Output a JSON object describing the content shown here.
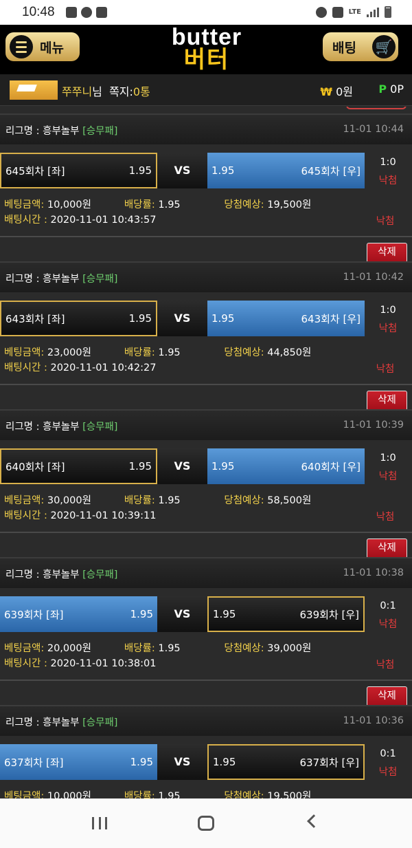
{
  "status": {
    "time": "10:48",
    "lte": "LTE"
  },
  "header": {
    "menu_label": "메뉴",
    "logo_en": "butter",
    "logo_ko": "버터",
    "bet_label": "배팅"
  },
  "user": {
    "nickname": "쭈쭈니",
    "suffix": "님",
    "note_label": "쪽지:",
    "note_count": "0통",
    "currency_symbol": "₩",
    "money": "0원",
    "points_symbol": "P",
    "points": "0P"
  },
  "labels": {
    "league_prefix": "리그명 : ",
    "amount_label": "베팅금액:",
    "rate_label": "배당률:",
    "expect_label": "당첨예상:",
    "time_label": "배팅시간 : ",
    "vs": "VS",
    "delete": "삭제"
  },
  "bets": [
    {
      "league": "흥부놀부",
      "tag": "[승무패]",
      "datetime": "11-01 10:44",
      "left_team": "645회차 [좌]",
      "left_odds": "1.95",
      "right_odds": "1.95",
      "right_team": "645회차 [우]",
      "score": "1:0",
      "result": "낙첨",
      "amount": "10,000원",
      "rate": "1.95",
      "expect": "19,500원",
      "bet_time": "2020-11-01 10:43:57",
      "result2": "낙첨",
      "selected": "left"
    },
    {
      "league": "흥부놀부",
      "tag": "[승무패]",
      "datetime": "11-01 10:42",
      "left_team": "643회차 [좌]",
      "left_odds": "1.95",
      "right_odds": "1.95",
      "right_team": "643회차 [우]",
      "score": "1:0",
      "result": "낙첨",
      "amount": "23,000원",
      "rate": "1.95",
      "expect": "44,850원",
      "bet_time": "2020-11-01 10:42:27",
      "result2": "낙첨",
      "selected": "left"
    },
    {
      "league": "흥부놀부",
      "tag": "[승무패]",
      "datetime": "11-01 10:39",
      "left_team": "640회차 [좌]",
      "left_odds": "1.95",
      "right_odds": "1.95",
      "right_team": "640회차 [우]",
      "score": "1:0",
      "result": "낙첨",
      "amount": "30,000원",
      "rate": "1.95",
      "expect": "58,500원",
      "bet_time": "2020-11-01 10:39:11",
      "result2": "낙첨",
      "selected": "left"
    },
    {
      "league": "흥부놀부",
      "tag": "[승무패]",
      "datetime": "11-01 10:38",
      "left_team": "639회차 [좌]",
      "left_odds": "1.95",
      "right_odds": "1.95",
      "right_team": "639회차 [우]",
      "score": "0:1",
      "result": "낙첨",
      "amount": "20,000원",
      "rate": "1.95",
      "expect": "39,000원",
      "bet_time": "2020-11-01 10:38:01",
      "result2": "낙첨",
      "selected": "right"
    },
    {
      "league": "흥부놀부",
      "tag": "[승무패]",
      "datetime": "11-01 10:36",
      "left_team": "637회차 [좌]",
      "left_odds": "1.95",
      "right_odds": "1.95",
      "right_team": "637회차 [우]",
      "score": "0:1",
      "result": "낙첨",
      "amount": "10,000원",
      "rate": "1.95",
      "expect": "19,500원",
      "bet_time": "",
      "result2": "",
      "selected": "right"
    }
  ]
}
